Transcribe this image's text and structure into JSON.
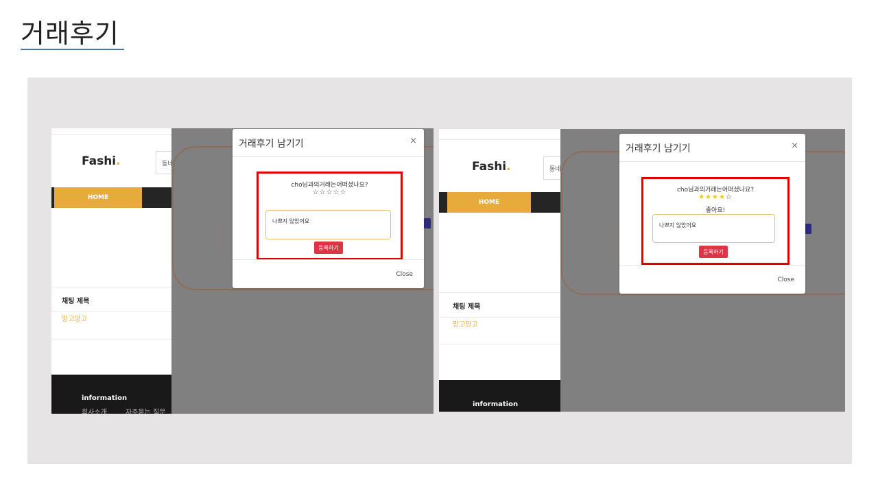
{
  "slide": {
    "title": "거래후기"
  },
  "site": {
    "logo": "Fashi",
    "logo_dot": ".",
    "search_placeholder": "동네",
    "nav_home": "HOME",
    "chat_title": "채팅 제목",
    "chat_item": "망고망고",
    "footer_title": "information",
    "footer_link_1": "회사소개",
    "footer_link_2": "자주묻는 질문"
  },
  "modal_before": {
    "title": "거래후기 남기기",
    "close_symbol": "×",
    "question": "cho님과의거래는어떠셨나요?",
    "stars": "☆☆☆☆☆",
    "stars_value": 0,
    "review_text": "나쁘지 않았어요",
    "submit_label": "등록하기",
    "footer_close": "Close"
  },
  "modal_after": {
    "title": "거래후기 남기기",
    "close_symbol": "×",
    "question": "cho님과의거래는어떠셨나요?",
    "stars_filled": "★★★★",
    "stars_empty": "☆",
    "stars_value": 4,
    "rating_text": "좋아요!",
    "review_text": "나쁘지 않았어요",
    "submit_label": "등록하기",
    "footer_close": "Close"
  },
  "colors": {
    "accent": "#e7ab3c",
    "highlight": "#e00000",
    "submit": "#dc3545",
    "star": "#f5c518",
    "panel": "#e6e4e5"
  }
}
